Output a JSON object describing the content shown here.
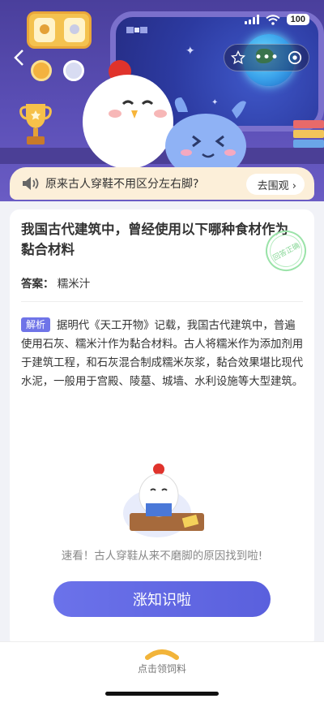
{
  "status_bar": {
    "battery": "100"
  },
  "top_nav": {
    "back_label": "<"
  },
  "notice": {
    "text": "原来古人穿鞋不用区分左右脚?",
    "button": "去围观 ›"
  },
  "card": {
    "question": "我国古代建筑中，曾经使用以下哪种食材作为黏合材料",
    "stamp": "回答正确",
    "answer_label": "答案：",
    "answer_value": "糯米汁",
    "explain_tag": "解析",
    "explain_text": "据明代《天工开物》记载，我国古代建筑中，普遍使用石灰、糯米汁作为黏合材料。古人将糯米作为添加剂用于建筑工程，和石灰混合制成糯米灰浆，黏合效果堪比现代水泥，一般用于宫殿、陵墓、城墙、水利设施等大型建筑。",
    "tip": "速看！古人穿鞋从来不磨脚的原因找到啦!",
    "main_button": "涨知识啦"
  },
  "bottom_bar": {
    "label": "点击领饲料"
  },
  "colors": {
    "accent": "#5d63e0",
    "hero_bg": "#4a3f9c",
    "notice_bg": "#fcefd9"
  }
}
